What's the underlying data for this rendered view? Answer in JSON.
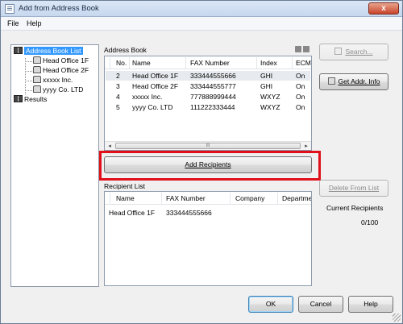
{
  "window": {
    "title": "Add from Address Book",
    "close_glyph": "x"
  },
  "menu": [
    "File",
    "Help"
  ],
  "tree": {
    "root": "Address Book List",
    "children": [
      "Head Office 1F",
      "Head Office 2F",
      "xxxxx Inc.",
      "yyyy Co. LTD"
    ],
    "results": "Results"
  },
  "address_book": {
    "label": "Address Book",
    "columns": [
      "No.",
      "Name",
      "FAX Number",
      "Index",
      "ECM"
    ],
    "rows": [
      [
        "2",
        "Head Office 1F",
        "333444555666",
        "GHI",
        "On"
      ],
      [
        "3",
        "Head Office 2F",
        "333444555777",
        "GHI",
        "On"
      ],
      [
        "4",
        "xxxxx Inc.",
        "777888999444",
        "WXYZ",
        "On"
      ],
      [
        "5",
        "yyyy Co. LTD",
        "111222333444",
        "WXYZ",
        "On"
      ]
    ]
  },
  "buttons": {
    "search": "Search...",
    "get_addr_info": "Get Addr. Info",
    "add_recipients": "Add Recipients",
    "delete_from_list": "Delete From List",
    "ok": "OK",
    "cancel": "Cancel",
    "help": "Help"
  },
  "recipient_list": {
    "label": "Recipient List",
    "columns": [
      "Name",
      "FAX Number",
      "Company",
      "Departmer"
    ],
    "rows": [
      [
        "Head Office 1F",
        "333444555666",
        "",
        ""
      ]
    ]
  },
  "current_recipients": {
    "label": "Current Recipients",
    "value": "0/100"
  },
  "scroll_glyphs": {
    "left": "◂",
    "right": "▸",
    "thumb": "III"
  },
  "colors": {
    "highlight": "#e0101a",
    "selection": "#3399ff"
  }
}
